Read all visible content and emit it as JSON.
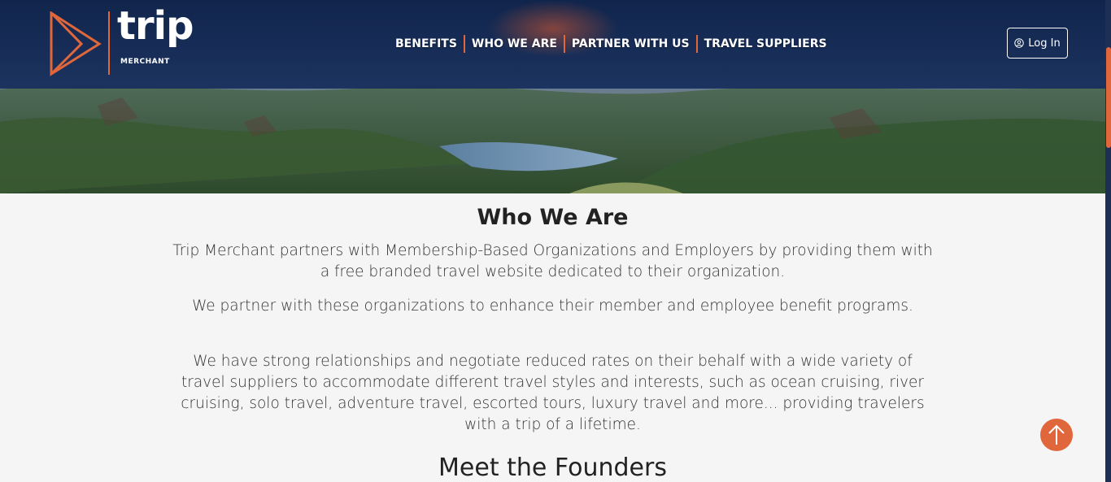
{
  "brand": {
    "logo_word": "trip",
    "logo_sub": "MERCHANT",
    "accent": "#e0673b",
    "navy": "#13285a"
  },
  "nav": {
    "items": [
      {
        "label": "BENEFITS"
      },
      {
        "label": "WHO WE ARE"
      },
      {
        "label": "PARTNER WITH US"
      },
      {
        "label": "TRAVEL SUPPLIERS"
      }
    ]
  },
  "header": {
    "login_label": "Log In",
    "login_icon": "user-circle-icon"
  },
  "main": {
    "title": "Who We Are",
    "paragraphs": [
      "Trip Merchant partners with Membership-Based Organizations and Employers by providing them with a free branded travel website dedicated to their organization.",
      "We partner with these organizations to enhance their member and employee benefit programs.",
      "We have strong relationships and negotiate reduced rates on their behalf with a wide variety of travel suppliers to accommodate different travel styles and interests, such as ocean cruising, river cruising, solo travel, adventure travel, escorted tours, luxury travel and more... providing travelers with a trip of a lifetime."
    ],
    "founders_title": "Meet the Founders"
  },
  "scroll_top": {
    "icon": "arrow-up-icon"
  }
}
